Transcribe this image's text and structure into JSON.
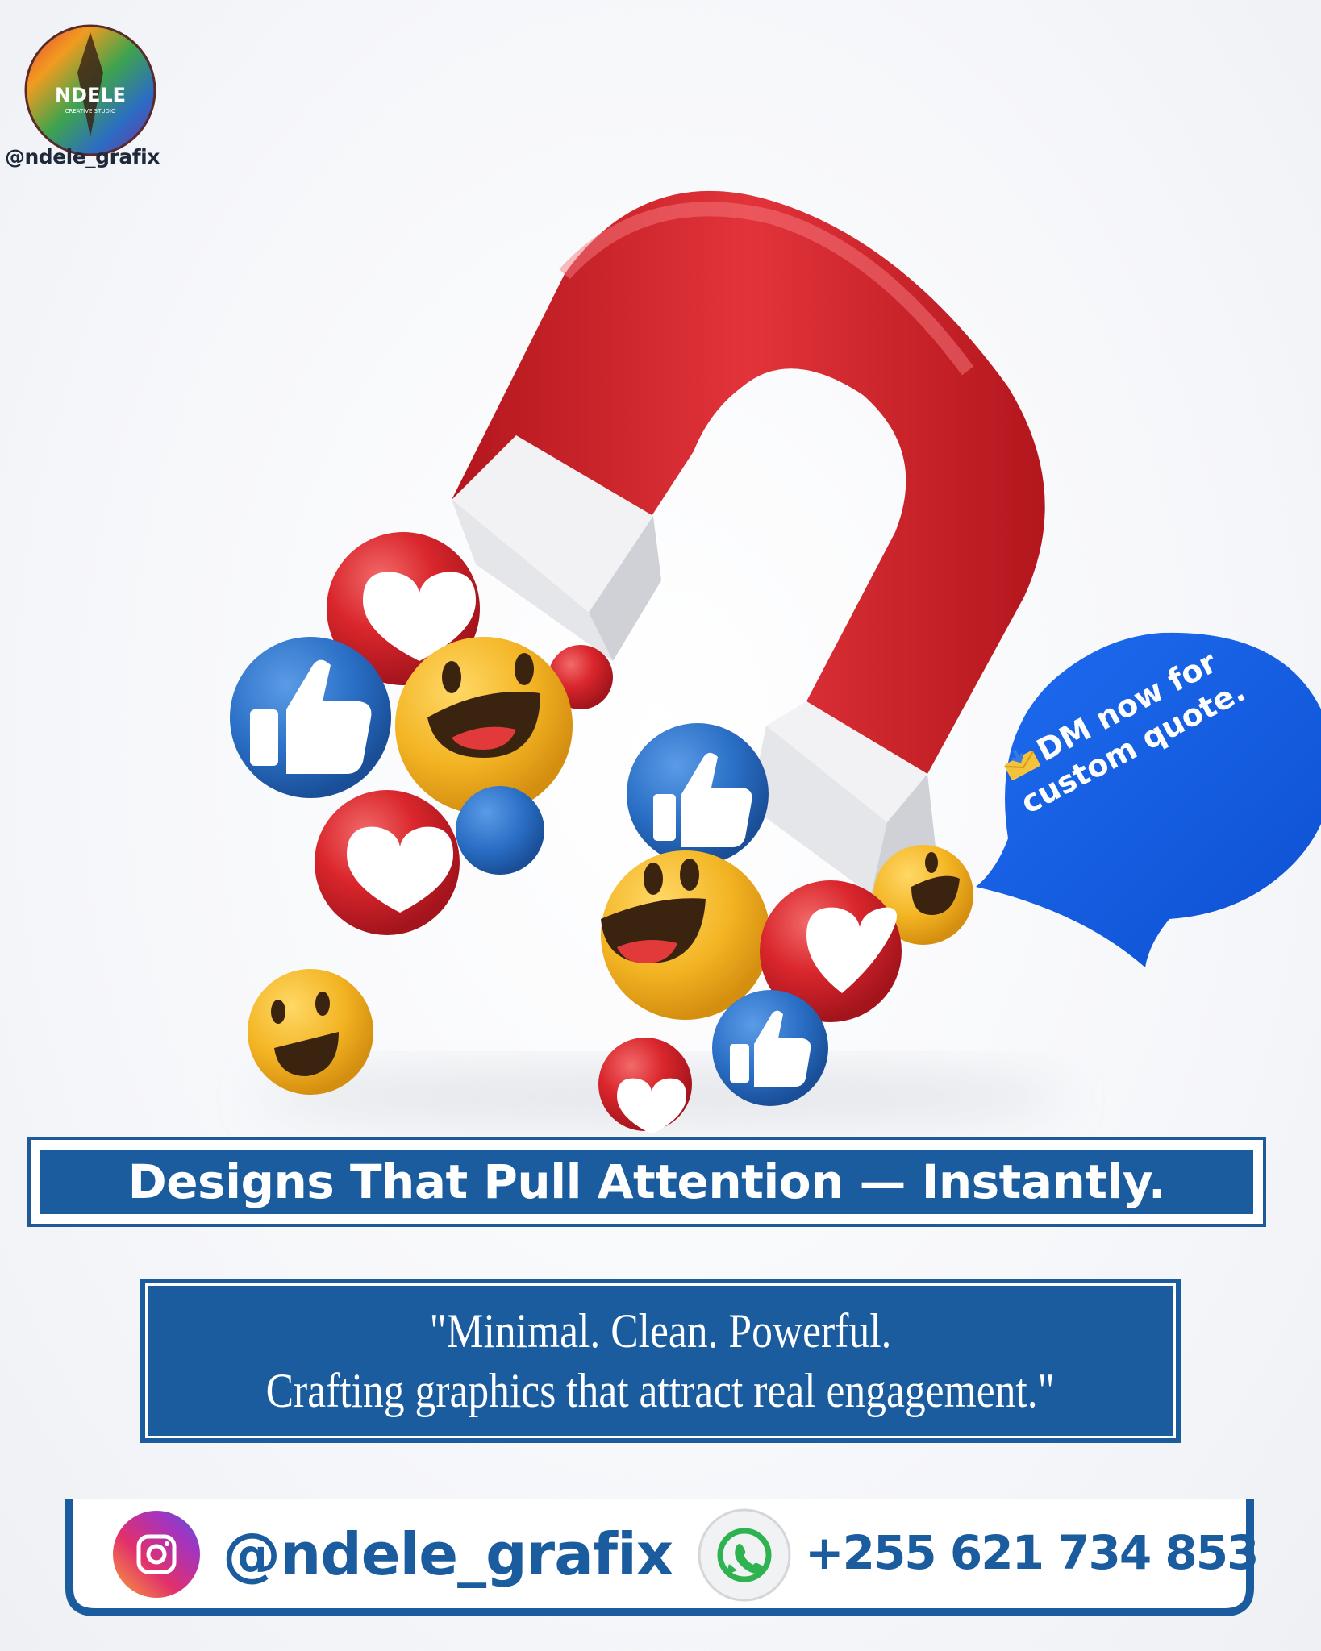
{
  "brand": {
    "logo_text": "NDELE",
    "logo_subtext": "CREATIVE STUDIO",
    "handle": "@ndele_grafix"
  },
  "bubble": {
    "line1": "DM now for",
    "line2": "custom quote.",
    "color": "#1e6cf0",
    "icon": "incoming-envelope-icon"
  },
  "headline": {
    "text": "Designs That Pull Attention — Instantly."
  },
  "quote": {
    "line1": "\"Minimal. Clean. Powerful.",
    "line2": "Crafting graphics that attract real engagement.\""
  },
  "contact": {
    "instagram_icon": "instagram-icon",
    "instagram_handle": "@ndele_grafix",
    "whatsapp_icon": "whatsapp-icon",
    "phone": "+255 621 734 853"
  },
  "colors": {
    "accent_blue": "#1b5c9f",
    "magnet_red": "#d9262c",
    "emoji_yellow": "#f3b423",
    "like_blue": "#2a6fc6"
  }
}
